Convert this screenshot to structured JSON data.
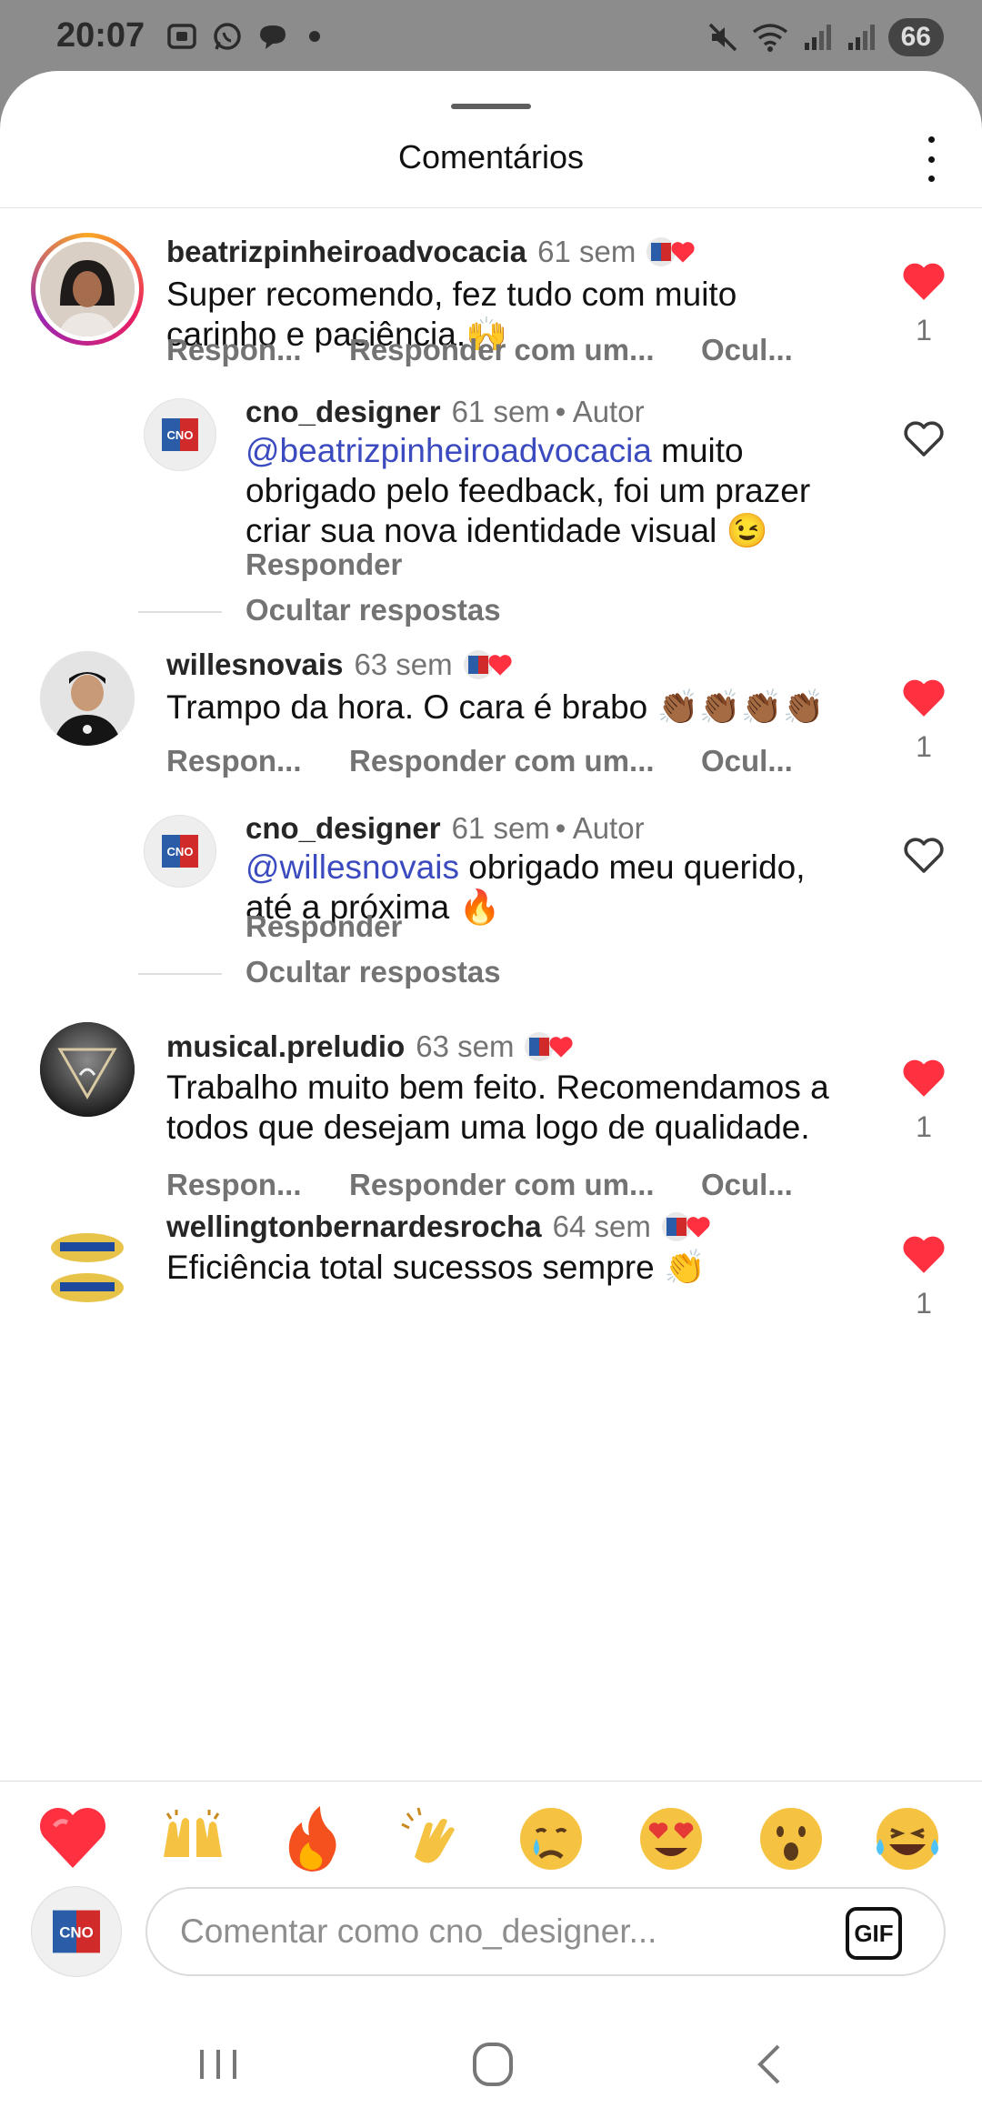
{
  "status_bar": {
    "time": "20:07",
    "battery": "66"
  },
  "header": {
    "title": "Comentários"
  },
  "comments": [
    {
      "username": "beatrizpinheiroadvocacia",
      "time": "61 sem",
      "text": "Super recomendo, fez tudo com muito carinho e paciência.🙌",
      "liked": true,
      "like_count": "1",
      "actions": [
        "Respon...",
        "Responder com um...",
        "Ocul..."
      ],
      "reply": {
        "username": "cno_designer",
        "time": "61 sem",
        "author_label": "• Autor",
        "mention": "@beatrizpinheiroadvocacia",
        "text": " muito obrigado pelo feedback, foi um prazer criar sua nova identidade visual 😉",
        "action": "Responder"
      },
      "hide_replies": "Ocultar respostas"
    },
    {
      "username": "willesnovais",
      "time": "63 sem",
      "text": "Trampo da hora.  O cara é brabo 👏🏾👏🏾👏🏾👏🏾",
      "liked": true,
      "like_count": "1",
      "actions": [
        "Respon...",
        "Responder com um...",
        "Ocul..."
      ],
      "reply": {
        "username": "cno_designer",
        "time": "61 sem",
        "author_label": "• Autor",
        "mention": "@willesnovais",
        "text": " obrigado meu querido, até a próxima 🔥",
        "action": "Responder"
      },
      "hide_replies": "Ocultar respostas"
    },
    {
      "username": "musical.preludio",
      "time": "63 sem",
      "text": "Trabalho muito bem feito. Recomendamos a todos que desejam uma logo de qualidade.",
      "liked": true,
      "like_count": "1",
      "actions": [
        "Respon...",
        "Responder com um...",
        "Ocul..."
      ]
    },
    {
      "username": "wellingtonbernardesrocha",
      "time": "64 sem",
      "text": "Eficiência total sucessos sempre 👏",
      "liked": true,
      "like_count": "1"
    }
  ],
  "quick_reactions": [
    "❤️",
    "🙌",
    "🔥",
    "👏",
    "😢",
    "😍",
    "😮",
    "😂"
  ],
  "composer": {
    "placeholder": "Comentar como cno_designer...",
    "gif_label": "GIF"
  },
  "logo_text": "CNO",
  "colors": {
    "like_red": "#ff3040",
    "mention_blue": "#3b4bbf",
    "muted": "#737373"
  },
  "icons": {
    "like_filled": "heart-filled-icon",
    "like_outline": "heart-outline-icon",
    "more": "more-vertical-icon"
  }
}
